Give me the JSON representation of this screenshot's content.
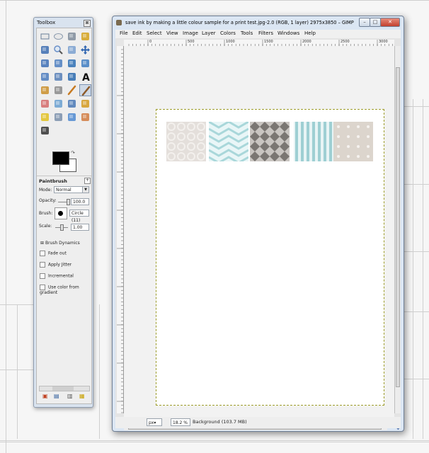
{
  "toolbox": {
    "title": "Toolbox",
    "close_glyph": "⊠",
    "tools": [
      "rect-select-icon",
      "ellipse-select-icon",
      "free-select-icon",
      "fuzzy-select-icon",
      "color-picker-icon",
      "zoom-icon",
      "measure-icon",
      "move-icon",
      "align-icon",
      "crop-icon",
      "rotate-icon",
      "scale-icon",
      "shear-icon",
      "perspective-icon",
      "flip-icon",
      "text-icon",
      "bucket-fill-icon",
      "blend-icon",
      "pencil-icon",
      "paintbrush-icon",
      "eraser-icon",
      "airbrush-icon",
      "ink-icon",
      "clone-icon",
      "heal-icon",
      "perspective-clone-icon",
      "blur-icon",
      "smudge-icon",
      "dodge-burn-icon"
    ],
    "swap_glyph": "↷",
    "options_title": "Paintbrush",
    "options_btn": "+",
    "mode_label": "Mode:",
    "mode_value": "Normal",
    "opacity_label": "Opacity:",
    "opacity_value": "100.0",
    "opacity_level": 1.0,
    "brush_label": "Brush:",
    "brush_value": "Circle (11)",
    "scale_label": "Scale:",
    "scale_value": "1.00",
    "scale_level": 0.5,
    "brush_dynamics_label": "Brush Dynamics",
    "checks": [
      "Fade out",
      "Apply Jitter",
      "Incremental",
      "Use color from gradient"
    ]
  },
  "image_window": {
    "title": "save ink by making a little colour sample for a print test.jpg-2.0 (RGB, 1 layer) 2975x3850 – GIMP",
    "menu": [
      "File",
      "Edit",
      "Select",
      "View",
      "Image",
      "Layer",
      "Colors",
      "Tools",
      "Filters",
      "Windows",
      "Help"
    ],
    "ruler_labels": [
      "0",
      "500",
      "1000",
      "1500",
      "2000",
      "2500",
      "3000"
    ],
    "unit": "px",
    "zoom": "18.2 %",
    "status": "Background (103.7 MB)",
    "window_buttons": [
      "–",
      "□",
      "✕"
    ]
  },
  "swatches": [
    {
      "name": "quatrefoil-swatch",
      "color": "#e4dfdb",
      "accent": "#f3f0ed"
    },
    {
      "name": "chevron-swatch",
      "color": "#a9d7da",
      "accent": "#e9f6f7"
    },
    {
      "name": "harlequin-swatch",
      "color": "#7a7672",
      "accent": "#c9c5c1"
    },
    {
      "name": "stripe-swatch",
      "color": "#9ecfd3",
      "accent": "#e8f4f5"
    },
    {
      "name": "dot-swatch",
      "color": "#dcd5cd",
      "accent": "#f5f2ef"
    }
  ]
}
